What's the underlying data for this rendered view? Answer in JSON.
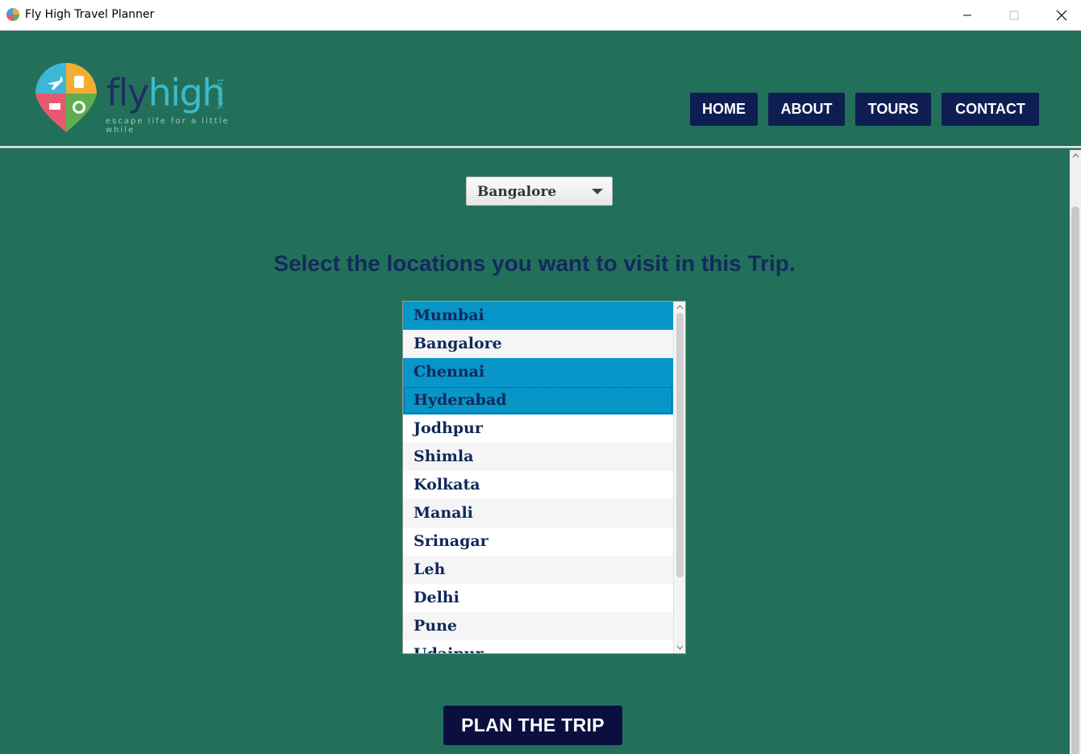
{
  "window": {
    "title": "Fly High Travel Planner",
    "icon": "globe-app-icon",
    "controls": [
      "minimize-icon",
      "maximize-icon",
      "close-icon"
    ]
  },
  "logo": {
    "word_part1": "fly",
    "word_part2": "high",
    "side_text": "travels",
    "tagline": "escape life for a little while"
  },
  "nav": {
    "home": "HOME",
    "about": "ABOUT",
    "tours": "TOURS",
    "contact": "CONTACT"
  },
  "source_city": {
    "selected": "Bangalore"
  },
  "heading": "Select the locations you want to visit in this Trip.",
  "locations": [
    {
      "label": "Mumbai",
      "selected": true
    },
    {
      "label": "Bangalore",
      "selected": false
    },
    {
      "label": "Chennai",
      "selected": true
    },
    {
      "label": "Hyderabad",
      "selected": true
    },
    {
      "label": "Jodhpur",
      "selected": false
    },
    {
      "label": "Shimla",
      "selected": false
    },
    {
      "label": "Kolkata",
      "selected": false
    },
    {
      "label": "Manali",
      "selected": false
    },
    {
      "label": "Srinagar",
      "selected": false
    },
    {
      "label": "Leh",
      "selected": false
    },
    {
      "label": "Delhi",
      "selected": false
    },
    {
      "label": "Pune",
      "selected": false
    },
    {
      "label": "Udaipur",
      "selected": false
    }
  ],
  "plan_button": "PLAN THE TRIP",
  "colors": {
    "background": "#22705a",
    "nav": "#0e1e52",
    "selection": "#0895c8",
    "heading": "#132a5c",
    "plan_button": "#0b0f40"
  }
}
